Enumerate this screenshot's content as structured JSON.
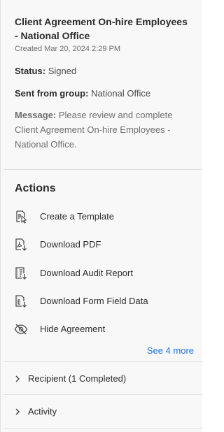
{
  "agreement": {
    "title": "Client Agreement On-hire Employees - National Office",
    "created": "Created Mar 20, 2024 2:29 PM",
    "status_label": "Status:",
    "status_value": "Signed",
    "group_label": "Sent from group:",
    "group_value": "National Office",
    "message_label": "Message:",
    "message_value": "Please review and complete Client Agreement On-hire Employees - National Office."
  },
  "actions": {
    "heading": "Actions",
    "items": [
      {
        "label": "Create a Template",
        "icon": "template-icon"
      },
      {
        "label": "Download PDF",
        "icon": "download-pdf-icon"
      },
      {
        "label": "Download Audit Report",
        "icon": "audit-report-icon"
      },
      {
        "label": "Download Form Field Data",
        "icon": "form-data-icon"
      },
      {
        "label": "Hide Agreement",
        "icon": "hide-icon"
      }
    ],
    "see_more": "See 4 more"
  },
  "sections": {
    "recipient": "Recipient (1 Completed)",
    "activity": "Activity"
  },
  "colors": {
    "link": "#1473e6",
    "panel_bg": "#f8f8f8"
  }
}
